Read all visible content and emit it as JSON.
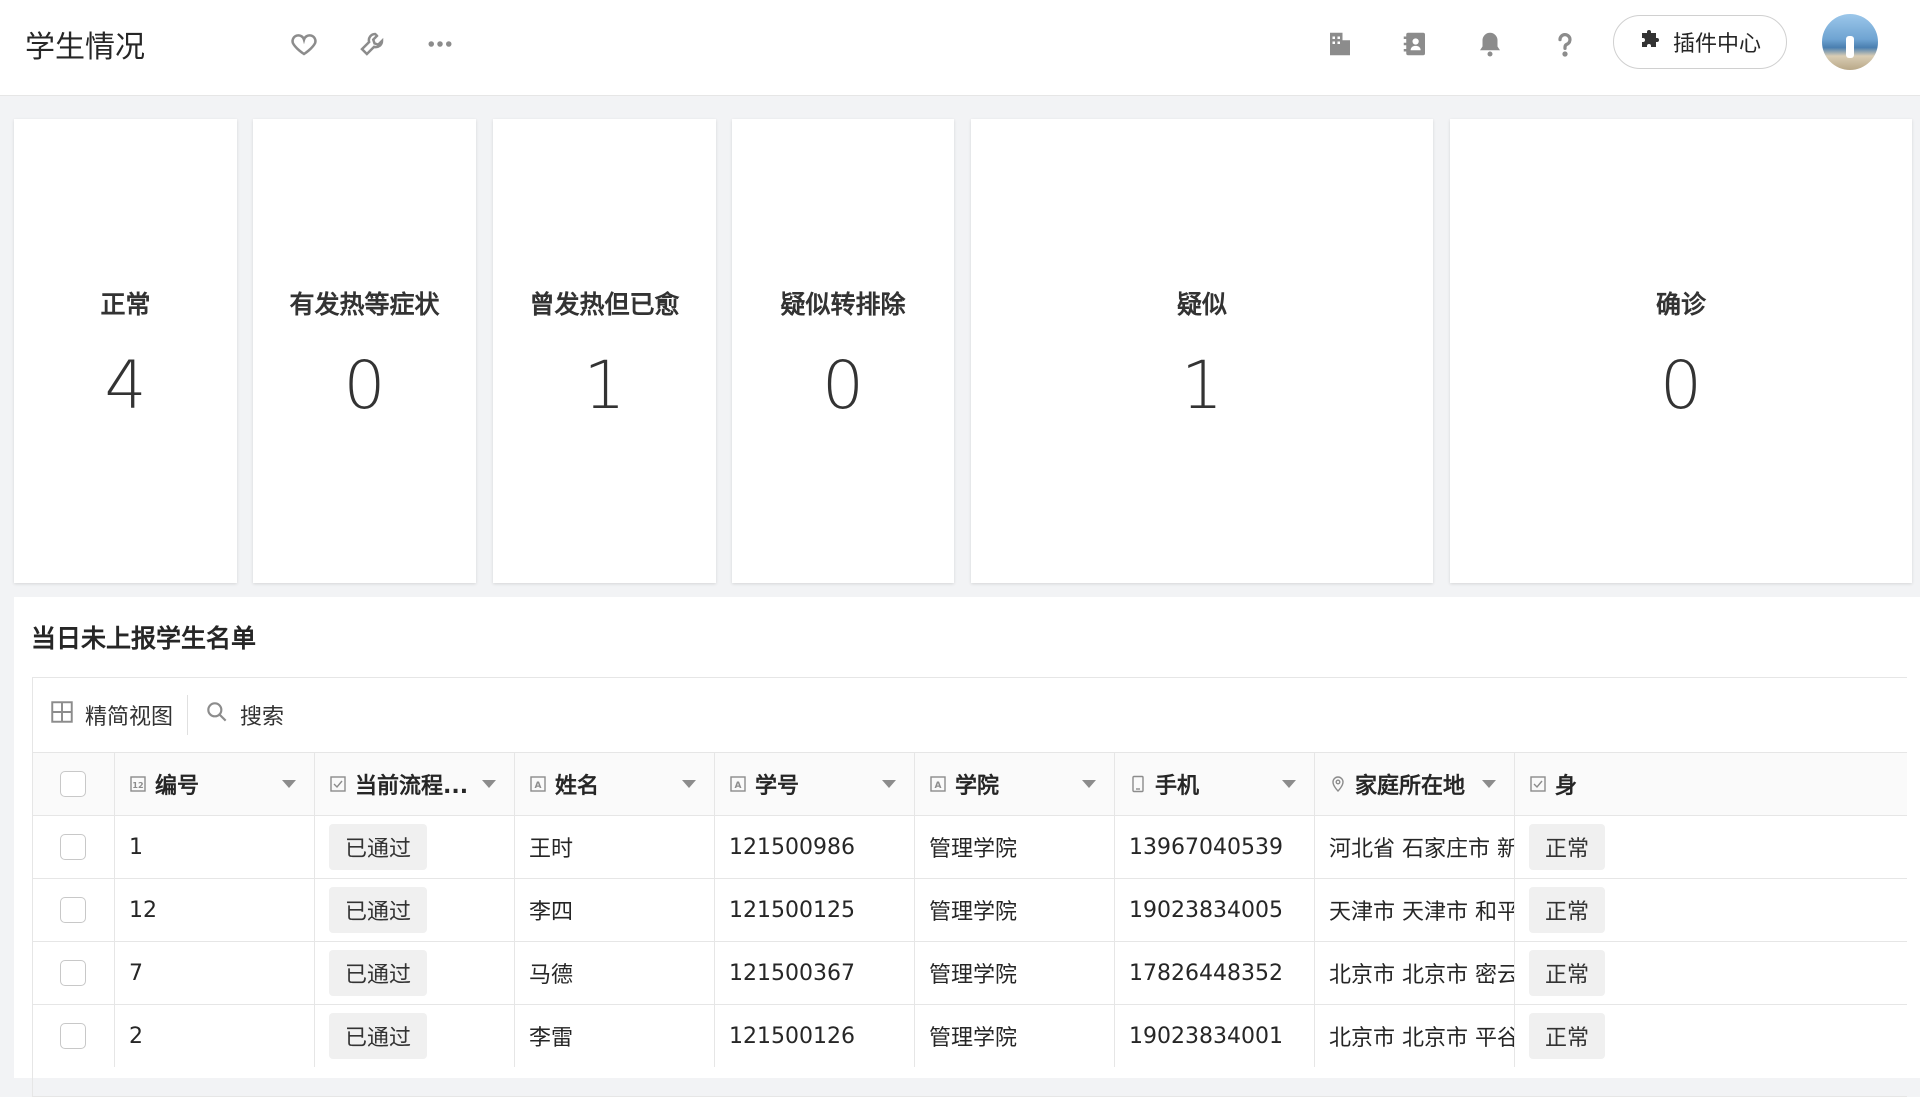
{
  "header": {
    "title": "学生情况",
    "plugin_center": "插件中心"
  },
  "stats": [
    {
      "label": "正常",
      "value": "4"
    },
    {
      "label": "有发热等症状",
      "value": "0"
    },
    {
      "label": "曾发热但已愈",
      "value": "1"
    },
    {
      "label": "疑似转排除",
      "value": "0"
    },
    {
      "label": "疑似",
      "value": "1"
    },
    {
      "label": "确诊",
      "value": "0"
    }
  ],
  "table": {
    "title": "当日未上报学生名单",
    "toolbar": {
      "view": "精简视图",
      "search": "搜索"
    },
    "columns": [
      "编号",
      "当前流程...",
      "姓名",
      "学号",
      "学院",
      "手机",
      "家庭所在地",
      "身"
    ],
    "rows": [
      {
        "id": "1",
        "status": "已通过",
        "name": "王时",
        "student_no": "121500986",
        "college": "管理学院",
        "phone": "13967040539",
        "address": "河北省 石家庄市 新...",
        "extra": "正常"
      },
      {
        "id": "12",
        "status": "已通过",
        "name": "李四",
        "student_no": "121500125",
        "college": "管理学院",
        "phone": "19023834005",
        "address": "天津市 天津市 和平...",
        "extra": "正常"
      },
      {
        "id": "7",
        "status": "已通过",
        "name": "马德",
        "student_no": "121500367",
        "college": "管理学院",
        "phone": "17826448352",
        "address": "北京市 北京市 密云...",
        "extra": "正常"
      },
      {
        "id": "2",
        "status": "已通过",
        "name": "李雷",
        "student_no": "121500126",
        "college": "管理学院",
        "phone": "19023834001",
        "address": "北京市 北京市 平谷...",
        "extra": "正常"
      }
    ]
  }
}
